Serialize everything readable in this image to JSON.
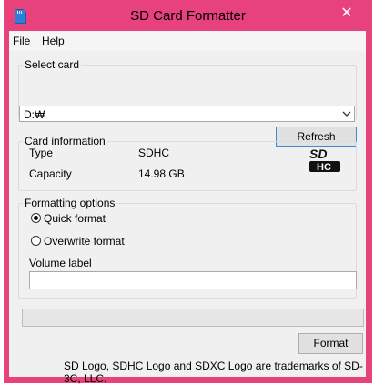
{
  "window": {
    "title": "SD Card Formatter",
    "close_glyph": "✕"
  },
  "menu": {
    "file": "File",
    "help": "Help"
  },
  "select_card": {
    "legend": "Select card",
    "selected": "D:₩",
    "refresh_label": "Refresh"
  },
  "card_info": {
    "legend": "Card information",
    "type_label": "Type",
    "type_value": "SDHC",
    "capacity_label": "Capacity",
    "capacity_value": "14.98 GB",
    "logo": "SDHC-logo"
  },
  "formatting": {
    "legend": "Formatting options",
    "quick_label": "Quick format",
    "quick_selected": true,
    "overwrite_label": "Overwrite format",
    "overwrite_selected": false,
    "volume_label": "Volume label",
    "volume_value": ""
  },
  "progress": {
    "percent": 0
  },
  "format_button": "Format",
  "footer": "SD Logo, SDHC Logo and SDXC Logo are trademarks of SD-3C, LLC.",
  "colors": {
    "frame": "#e8427c",
    "client": "#f0f0f0",
    "focus": "#3c8ad8"
  }
}
